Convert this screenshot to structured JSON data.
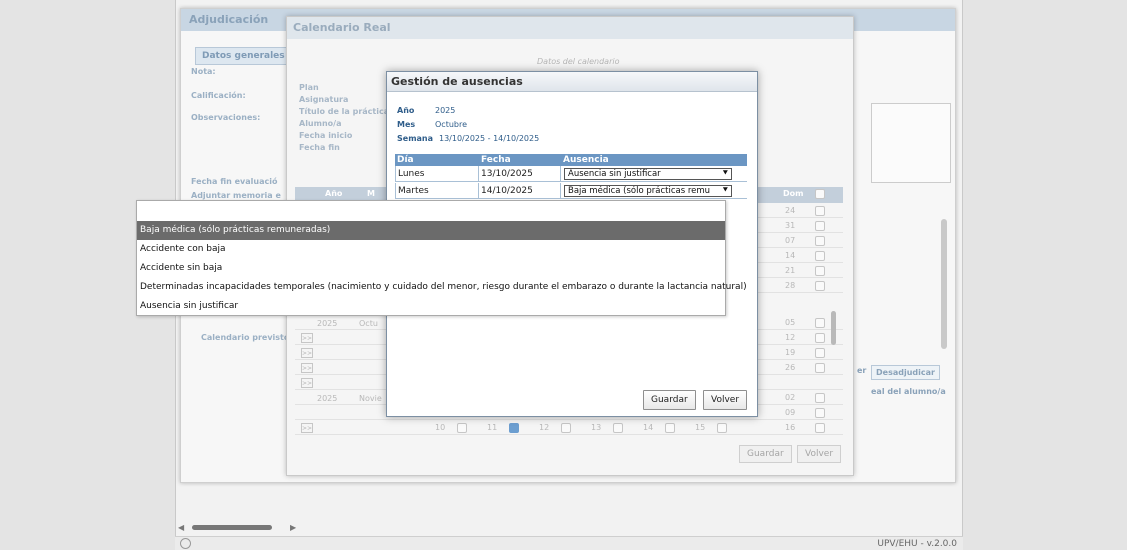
{
  "app": {
    "version": "UPV/EHU - v.2.0.0"
  },
  "adjudicacion": {
    "title": "Adjudicación",
    "tab": "Datos generales",
    "labels": {
      "nota": "Nota:",
      "calificacion": "Calificación:",
      "observaciones": "Observaciones:",
      "fecha_fin_eval": "Fecha fin evaluació",
      "adjuntar": "Adjuntar memoria e",
      "calendario_previsto": "Calendario previsto"
    },
    "btn_partial": "er",
    "btn_desadjudicar": "Desadjudicar",
    "link_real": "eal del alumno/a"
  },
  "calendario": {
    "title": "Calendario Real",
    "subtitle": "Datos del calendario",
    "labels": [
      "Plan",
      "Asignatura",
      "Título de la práctica",
      "Alumno/a",
      "Fecha inicio",
      "Fecha fin"
    ],
    "header": {
      "anio": "Año",
      "mes": "M",
      "dom": "Dom"
    },
    "year_a": "2025",
    "month_a": "Octu",
    "year_b": "2025",
    "month_b": "Novie",
    "dom_values": [
      "24",
      "31",
      "07",
      "14",
      "21",
      "28",
      "05",
      "12",
      "19",
      "26",
      "02",
      "09",
      "16"
    ],
    "last_row_days": [
      "10",
      "11",
      "12",
      "13",
      "14",
      "15"
    ],
    "expander": ">>",
    "btn_guardar": "Guardar",
    "btn_volver": "Volver"
  },
  "dialog": {
    "title": "Gestión de ausencias",
    "anio_label": "Año",
    "anio_value": "2025",
    "mes_label": "Mes",
    "mes_value": "Octubre",
    "semana_label": "Semana",
    "semana_value": "13/10/2025 - 14/10/2025",
    "columns": {
      "dia": "Día",
      "fecha": "Fecha",
      "ausencia": "Ausencia"
    },
    "rows": [
      {
        "dia": "Lunes",
        "fecha": "13/10/2025",
        "ausencia": "Ausencia sin justificar"
      },
      {
        "dia": "Martes",
        "fecha": "14/10/2025",
        "ausencia": "Baja médica (sólo prácticas remu"
      }
    ],
    "btn_guardar": "Guardar",
    "btn_volver": "Volver"
  },
  "dropdown": {
    "options": [
      "Baja médica (sólo prácticas remuneradas)",
      "Accidente con baja",
      "Accidente sin baja",
      "Determinadas incapacidades temporales (nacimiento y cuidado del menor, riesgo durante el embarazo o durante la lactancia natural)",
      "Ausencia sin justificar"
    ],
    "selected_index": 0
  },
  "icons": {
    "chevron": "chevron-down-icon",
    "settings": "gear-icon",
    "checkbox": "checkbox-icon"
  },
  "colors": {
    "dialog_header": "#6b96c3",
    "dialog_label": "#2f5d8a",
    "dropdown_selected": "#6b6b6b"
  }
}
